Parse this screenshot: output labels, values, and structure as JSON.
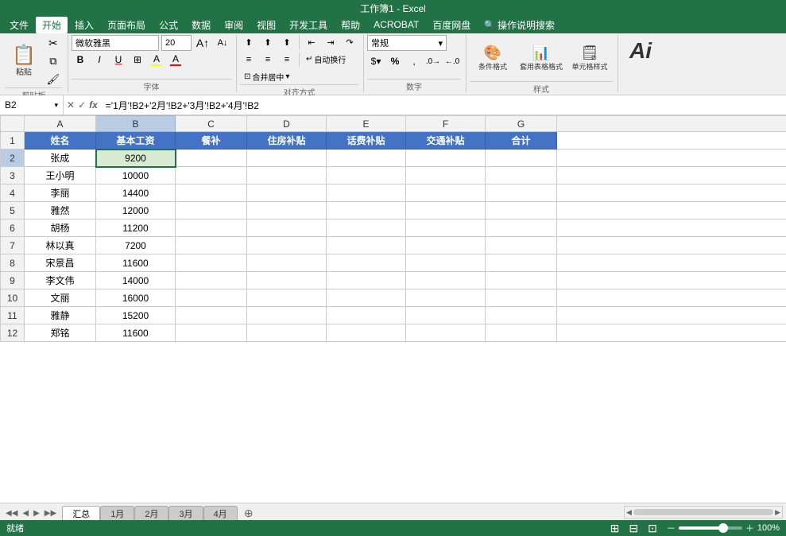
{
  "title": "工作簿1 - Excel",
  "menu": {
    "items": [
      "文件",
      "开始",
      "插入",
      "页面布局",
      "公式",
      "数据",
      "审阅",
      "视图",
      "开发工具",
      "帮助",
      "ACROBAT",
      "百度网盘",
      "操作说明搜索"
    ]
  },
  "ribbon": {
    "clipboard": {
      "label": "剪贴板",
      "paste": "粘贴",
      "cut": "✂",
      "copy": "❐",
      "format_painter": "🖌"
    },
    "font": {
      "label": "字体",
      "name": "微软雅黑",
      "size": "20",
      "bold": "B",
      "italic": "I",
      "underline": "U",
      "border": "⊞",
      "fill": "A",
      "color": "A"
    },
    "alignment": {
      "label": "对齐方式",
      "wrap_text": "自动换行",
      "merge_center": "合并居中"
    },
    "number": {
      "label": "数字",
      "format": "常规"
    },
    "styles": {
      "label": "样式",
      "conditional": "条件格式",
      "table": "套用表格格式",
      "cell": "单元格样式"
    }
  },
  "formula_bar": {
    "cell_ref": "B2",
    "formula": "='1月'!B2+'2月'!B2+'3月'!B2+'4月'!B2"
  },
  "columns": {
    "headers": [
      "A",
      "B",
      "C",
      "D",
      "E",
      "F",
      "G"
    ],
    "widths": [
      80,
      90,
      80,
      90,
      90,
      90,
      80
    ]
  },
  "header_row": {
    "label": "1",
    "cells": [
      "姓名",
      "基本工资",
      "餐补",
      "住房补贴",
      "话费补贴",
      "交通补贴",
      "合计"
    ]
  },
  "data_rows": [
    {
      "row": "2",
      "cells": [
        "张成",
        "9200",
        "",
        "",
        "",
        "",
        ""
      ]
    },
    {
      "row": "3",
      "cells": [
        "王小明",
        "10000",
        "",
        "",
        "",
        "",
        ""
      ]
    },
    {
      "row": "4",
      "cells": [
        "李丽",
        "14400",
        "",
        "",
        "",
        "",
        ""
      ]
    },
    {
      "row": "5",
      "cells": [
        "雅然",
        "12000",
        "",
        "",
        "",
        "",
        ""
      ]
    },
    {
      "row": "6",
      "cells": [
        "胡杨",
        "11200",
        "",
        "",
        "",
        "",
        ""
      ]
    },
    {
      "row": "7",
      "cells": [
        "林以真",
        "7200",
        "",
        "",
        "",
        "",
        ""
      ]
    },
    {
      "row": "8",
      "cells": [
        "宋景昌",
        "11600",
        "",
        "",
        "",
        "",
        ""
      ]
    },
    {
      "row": "9",
      "cells": [
        "李文伟",
        "14000",
        "",
        "",
        "",
        "",
        ""
      ]
    },
    {
      "row": "10",
      "cells": [
        "文丽",
        "16000",
        "",
        "",
        "",
        "",
        ""
      ]
    },
    {
      "row": "11",
      "cells": [
        "雅静",
        "15200",
        "",
        "",
        "",
        "",
        ""
      ]
    },
    {
      "row": "12",
      "cells": [
        "郑铭",
        "11600",
        "",
        "",
        "",
        "",
        ""
      ]
    }
  ],
  "tabs": {
    "items": [
      "汇总",
      "1月",
      "2月",
      "3月",
      "4月"
    ],
    "active": "汇总"
  },
  "status": {
    "items": [
      "就绪",
      "",
      "",
      "",
      ""
    ]
  }
}
